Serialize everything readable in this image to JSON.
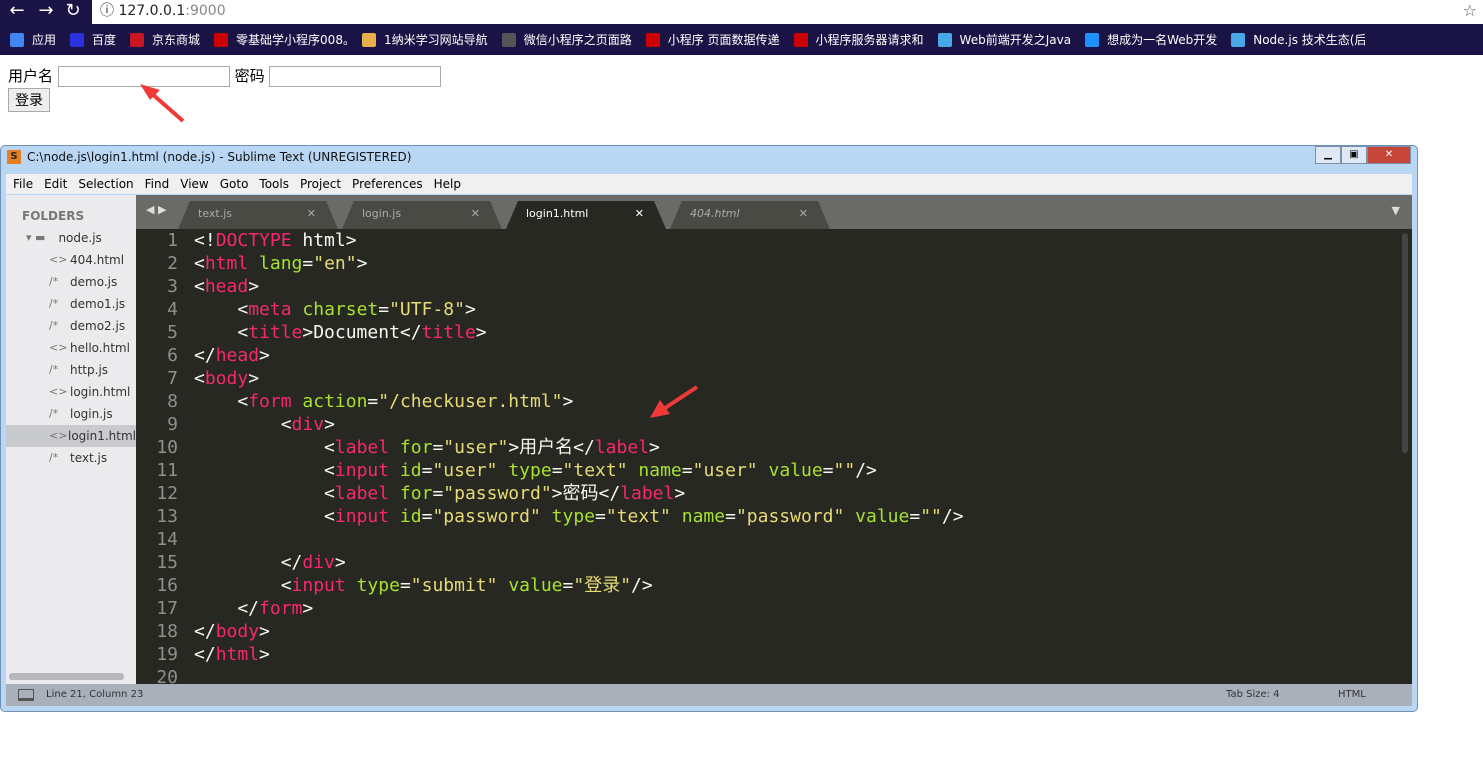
{
  "browser": {
    "url_host": "127.0.0.1",
    "url_port": ":9000",
    "bookmarks": [
      {
        "label": "应用",
        "icon": "apps-icon",
        "color": "#4285f4"
      },
      {
        "label": "百度",
        "icon": "baidu-icon",
        "color": "#2932e1"
      },
      {
        "label": "京东商城",
        "icon": "jd-icon",
        "color": "#c81623"
      },
      {
        "label": "零基础学小程序008。",
        "icon": "csdn-icon",
        "color": "#c00"
      },
      {
        "label": "1纳米学习网站导航",
        "icon": "at-icon",
        "color": "#e8b04a"
      },
      {
        "label": "微信小程序之页面路",
        "icon": "wechat-icon",
        "color": "#555"
      },
      {
        "label": "小程序 页面数据传递",
        "icon": "csdn-icon",
        "color": "#c00"
      },
      {
        "label": "小程序服务器请求和",
        "icon": "csdn-icon",
        "color": "#c00"
      },
      {
        "label": "Web前端开发之Java",
        "icon": "gem-icon",
        "color": "#4aa8e8"
      },
      {
        "label": "想成为一名Web开发",
        "icon": "gem-icon",
        "color": "#1e90ff"
      },
      {
        "label": "Node.js 技术生态(后",
        "icon": "gem-icon",
        "color": "#4aa8e8"
      }
    ]
  },
  "page": {
    "user_label": "用户名",
    "password_label": "密码",
    "submit": "登录",
    "user_value": "",
    "password_value": ""
  },
  "editor": {
    "title": "C:\\node.js\\login1.html (node.js) - Sublime Text (UNREGISTERED)",
    "menu": [
      "File",
      "Edit",
      "Selection",
      "Find",
      "View",
      "Goto",
      "Tools",
      "Project",
      "Preferences",
      "Help"
    ],
    "folders_label": "FOLDERS",
    "root": "node.js",
    "files": [
      {
        "g": "<>",
        "n": "404.html"
      },
      {
        "g": "/*",
        "n": "demo.js"
      },
      {
        "g": "/*",
        "n": "demo1.js"
      },
      {
        "g": "/*",
        "n": "demo2.js"
      },
      {
        "g": "<>",
        "n": "hello.html"
      },
      {
        "g": "/*",
        "n": "http.js"
      },
      {
        "g": "<>",
        "n": "login.html"
      },
      {
        "g": "/*",
        "n": "login.js"
      },
      {
        "g": "<>",
        "n": "login1.html",
        "sel": true
      },
      {
        "g": "/*",
        "n": "text.js"
      }
    ],
    "tabs": [
      {
        "label": "text.js"
      },
      {
        "label": "login.js"
      },
      {
        "label": "login1.html",
        "active": true
      },
      {
        "label": "404.html",
        "italic": true
      }
    ],
    "code": [
      [
        [
          "p",
          "<!"
        ],
        [
          "t",
          "DOCTYPE"
        ],
        [
          "p",
          " html>"
        ]
      ],
      [
        [
          "p",
          "<"
        ],
        [
          "t",
          "html"
        ],
        [
          "p",
          " "
        ],
        [
          "a",
          "lang"
        ],
        [
          "p",
          "="
        ],
        [
          "s",
          "\"en\""
        ],
        [
          "p",
          ">"
        ]
      ],
      [
        [
          "p",
          "<"
        ],
        [
          "t",
          "head"
        ],
        [
          "p",
          ">"
        ]
      ],
      [
        [
          "p",
          "    <"
        ],
        [
          "t",
          "meta"
        ],
        [
          "p",
          " "
        ],
        [
          "a",
          "charset"
        ],
        [
          "p",
          "="
        ],
        [
          "s",
          "\"UTF-8\""
        ],
        [
          "p",
          ">"
        ]
      ],
      [
        [
          "p",
          "    <"
        ],
        [
          "t",
          "title"
        ],
        [
          "p",
          ">Document</"
        ],
        [
          "t",
          "title"
        ],
        [
          "p",
          ">"
        ]
      ],
      [
        [
          "p",
          "</"
        ],
        [
          "t",
          "head"
        ],
        [
          "p",
          ">"
        ]
      ],
      [
        [
          "p",
          "<"
        ],
        [
          "t",
          "body"
        ],
        [
          "p",
          ">"
        ]
      ],
      [
        [
          "p",
          "    <"
        ],
        [
          "t",
          "form"
        ],
        [
          "p",
          " "
        ],
        [
          "a",
          "action"
        ],
        [
          "p",
          "="
        ],
        [
          "s",
          "\"/checkuser.html\""
        ],
        [
          "p",
          ">"
        ]
      ],
      [
        [
          "p",
          "        <"
        ],
        [
          "t",
          "div"
        ],
        [
          "p",
          ">"
        ]
      ],
      [
        [
          "p",
          "            <"
        ],
        [
          "t",
          "label"
        ],
        [
          "p",
          " "
        ],
        [
          "a",
          "for"
        ],
        [
          "p",
          "="
        ],
        [
          "s",
          "\"user\""
        ],
        [
          "p",
          ">用户名</"
        ],
        [
          "t",
          "label"
        ],
        [
          "p",
          ">"
        ]
      ],
      [
        [
          "p",
          "            <"
        ],
        [
          "t",
          "input"
        ],
        [
          "p",
          " "
        ],
        [
          "a",
          "id"
        ],
        [
          "p",
          "="
        ],
        [
          "s",
          "\"user\""
        ],
        [
          "p",
          " "
        ],
        [
          "a",
          "type"
        ],
        [
          "p",
          "="
        ],
        [
          "s",
          "\"text\""
        ],
        [
          "p",
          " "
        ],
        [
          "a",
          "name"
        ],
        [
          "p",
          "="
        ],
        [
          "s",
          "\"user\""
        ],
        [
          "p",
          " "
        ],
        [
          "a",
          "value"
        ],
        [
          "p",
          "="
        ],
        [
          "s",
          "\"\""
        ],
        [
          "p",
          "/>"
        ]
      ],
      [
        [
          "p",
          "            <"
        ],
        [
          "t",
          "label"
        ],
        [
          "p",
          " "
        ],
        [
          "a",
          "for"
        ],
        [
          "p",
          "="
        ],
        [
          "s",
          "\"password\""
        ],
        [
          "p",
          ">密码</"
        ],
        [
          "t",
          "label"
        ],
        [
          "p",
          ">"
        ]
      ],
      [
        [
          "p",
          "            <"
        ],
        [
          "t",
          "input"
        ],
        [
          "p",
          " "
        ],
        [
          "a",
          "id"
        ],
        [
          "p",
          "="
        ],
        [
          "s",
          "\"password\""
        ],
        [
          "p",
          " "
        ],
        [
          "a",
          "type"
        ],
        [
          "p",
          "="
        ],
        [
          "s",
          "\"text\""
        ],
        [
          "p",
          " "
        ],
        [
          "a",
          "name"
        ],
        [
          "p",
          "="
        ],
        [
          "s",
          "\"password\""
        ],
        [
          "p",
          " "
        ],
        [
          "a",
          "value"
        ],
        [
          "p",
          "="
        ],
        [
          "s",
          "\"\""
        ],
        [
          "p",
          "/>"
        ]
      ],
      [],
      [
        [
          "p",
          "        </"
        ],
        [
          "t",
          "div"
        ],
        [
          "p",
          ">"
        ]
      ],
      [
        [
          "p",
          "        <"
        ],
        [
          "t",
          "input"
        ],
        [
          "p",
          " "
        ],
        [
          "a",
          "type"
        ],
        [
          "p",
          "="
        ],
        [
          "s",
          "\"submit\""
        ],
        [
          "p",
          " "
        ],
        [
          "a",
          "value"
        ],
        [
          "p",
          "="
        ],
        [
          "s",
          "\"登录\""
        ],
        [
          "p",
          "/>"
        ]
      ],
      [
        [
          "p",
          "    </"
        ],
        [
          "t",
          "form"
        ],
        [
          "p",
          ">"
        ]
      ],
      [
        [
          "p",
          "</"
        ],
        [
          "t",
          "body"
        ],
        [
          "p",
          ">"
        ]
      ],
      [
        [
          "p",
          "</"
        ],
        [
          "t",
          "html"
        ],
        [
          "p",
          ">"
        ]
      ],
      []
    ],
    "status": {
      "position": "Line 21, Column 23",
      "tab_size": "Tab Size: 4",
      "syntax": "HTML"
    }
  }
}
